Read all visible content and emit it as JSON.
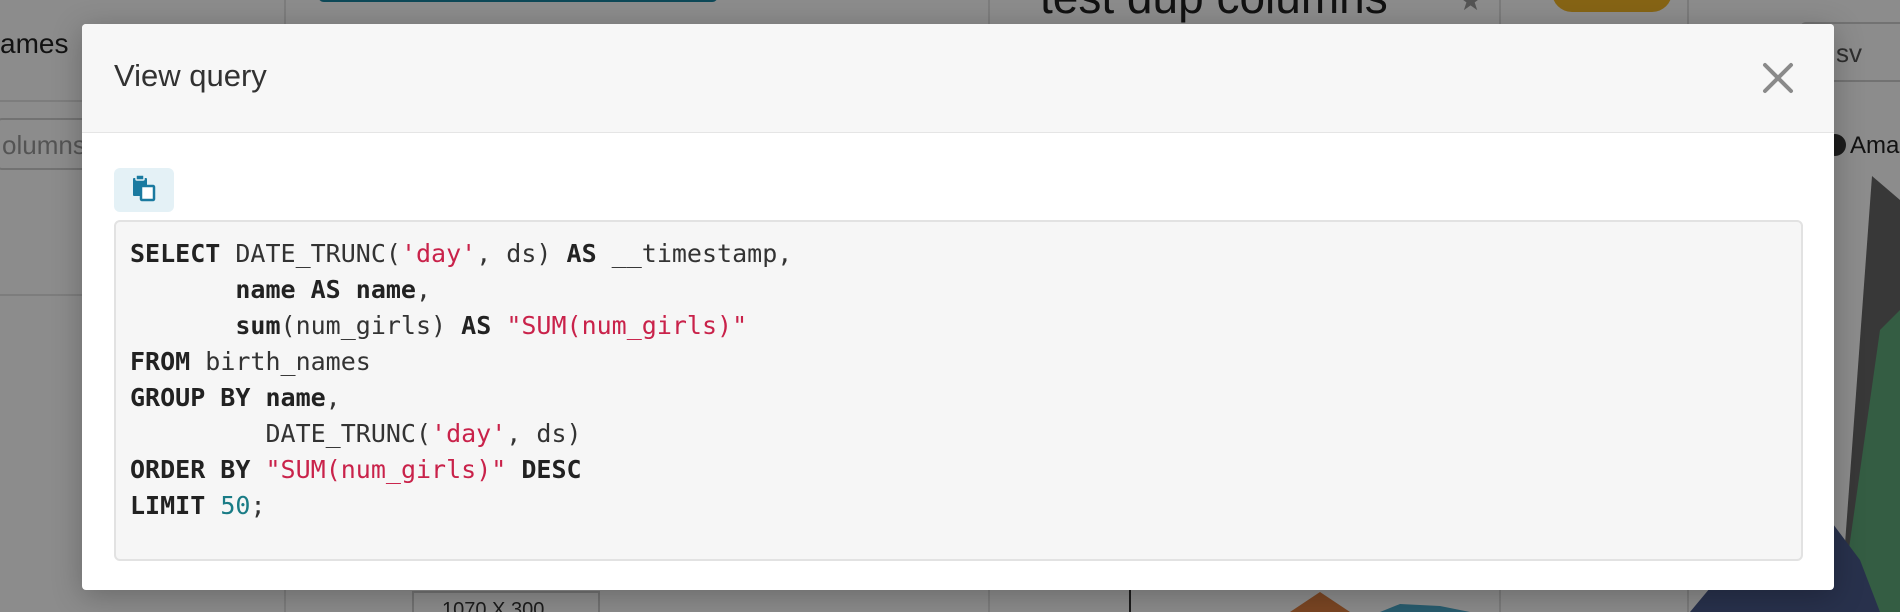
{
  "background": {
    "left_panel_title": "ames",
    "columns_placeholder": "olumns",
    "chart_title": "test dup columns",
    "star_icon": "star-icon",
    "csv_button": "sv",
    "legend_label": "Amar",
    "size_label": "1070 X 300"
  },
  "modal": {
    "title": "View query",
    "close_icon": "close-icon",
    "copy_icon": "copy-icon",
    "colors": {
      "keyword": "#222222",
      "string": "#c9224a",
      "number": "#1a7c86"
    },
    "code_lines": [
      [
        {
          "t": "SELECT",
          "k": "kw"
        },
        {
          "t": " DATE_TRUNC(",
          "k": "plain"
        },
        {
          "t": "'day'",
          "k": "str"
        },
        {
          "t": ", ds) ",
          "k": "plain"
        },
        {
          "t": "AS",
          "k": "kw"
        },
        {
          "t": " __timestamp,",
          "k": "plain"
        }
      ],
      [
        {
          "t": "       ",
          "k": "plain"
        },
        {
          "t": "name AS name",
          "k": "kw"
        },
        {
          "t": ",",
          "k": "plain"
        }
      ],
      [
        {
          "t": "       ",
          "k": "plain"
        },
        {
          "t": "sum",
          "k": "kw"
        },
        {
          "t": "(num_girls) ",
          "k": "plain"
        },
        {
          "t": "AS",
          "k": "kw"
        },
        {
          "t": " ",
          "k": "plain"
        },
        {
          "t": "\"SUM(num_girls)\"",
          "k": "str"
        }
      ],
      [
        {
          "t": "FROM",
          "k": "kw"
        },
        {
          "t": " birth_names",
          "k": "plain"
        }
      ],
      [
        {
          "t": "GROUP BY name",
          "k": "kw"
        },
        {
          "t": ",",
          "k": "plain"
        }
      ],
      [
        {
          "t": "         DATE_TRUNC(",
          "k": "plain"
        },
        {
          "t": "'day'",
          "k": "str"
        },
        {
          "t": ", ds)",
          "k": "plain"
        }
      ],
      [
        {
          "t": "ORDER BY",
          "k": "kw"
        },
        {
          "t": " ",
          "k": "plain"
        },
        {
          "t": "\"SUM(num_girls)\"",
          "k": "str"
        },
        {
          "t": " ",
          "k": "plain"
        },
        {
          "t": "DESC",
          "k": "kw"
        }
      ],
      [
        {
          "t": "LIMIT",
          "k": "kw"
        },
        {
          "t": " ",
          "k": "plain"
        },
        {
          "t": "50",
          "k": "num"
        },
        {
          "t": ";",
          "k": "plain"
        }
      ]
    ]
  }
}
